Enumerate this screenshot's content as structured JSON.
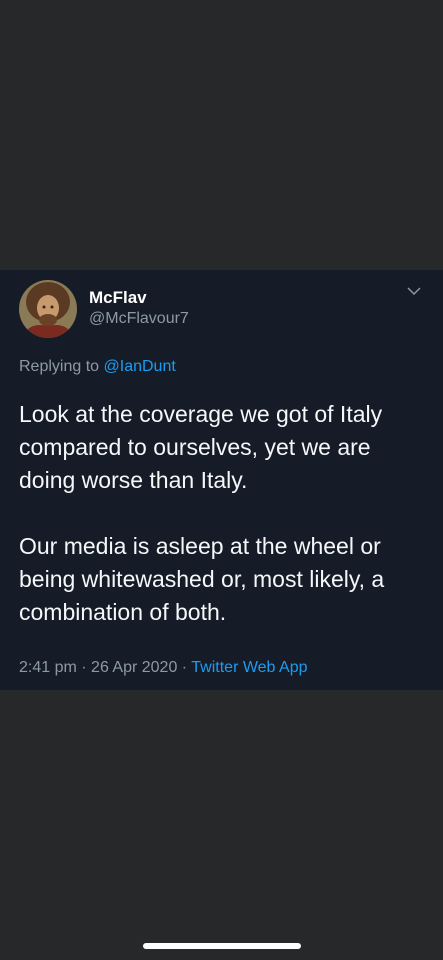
{
  "tweet": {
    "display_name": "McFlav",
    "handle": "@McFlavour7",
    "replying_prefix": "Replying to",
    "replying_to": "@IanDunt",
    "paragraph_1": "Look at the coverage we got of Italy compared to ourselves, yet we are doing worse than Italy.",
    "paragraph_2": "Our media is asleep at the wheel or being whitewashed or, most likely, a combination of both.",
    "time": "2:41 pm",
    "separator": "·",
    "date": "26 Apr 2020",
    "source": "Twitter Web App"
  },
  "colors": {
    "page_bg": "#272829",
    "card_bg": "#151c28",
    "link": "#1d9bf0",
    "muted": "#8d99a6"
  },
  "icons": {
    "more": "chevron-down-icon"
  }
}
